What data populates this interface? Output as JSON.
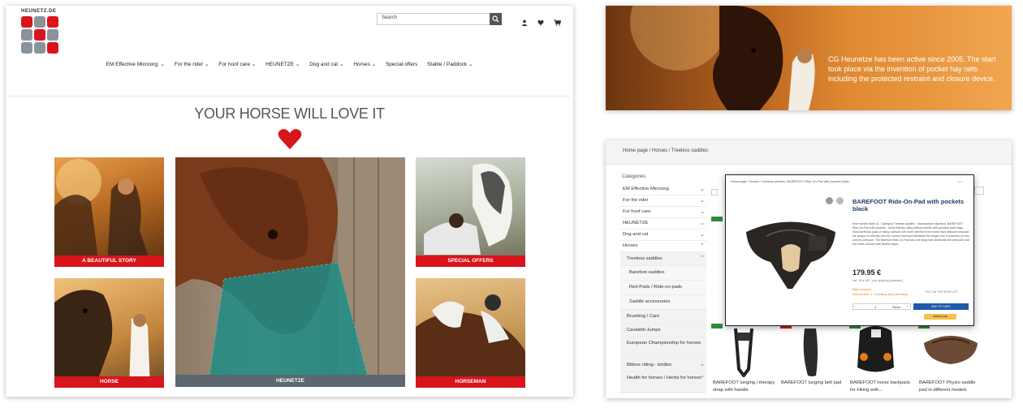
{
  "brand": {
    "logo_text": "HEUNETZ.DE"
  },
  "header": {
    "search_placeholder": "Search"
  },
  "nav": {
    "items": [
      "EM Effective Microorg. ⌄",
      "For the rider ⌄",
      "For hoof care ⌄",
      "HEUNETZE ⌄",
      "Dog and cat ⌄",
      "Horses ⌄",
      "Special offers",
      "Stable / Paddock ⌄"
    ]
  },
  "home": {
    "headline": "YOUR HORSE WILL LOVE IT",
    "tiles": [
      "A BEAUTIFUL STORY",
      "HEUNETZE",
      "SPECIAL OFFERS",
      "HORSE",
      "HORSEMAN"
    ]
  },
  "banner": {
    "text": "CG Heunetze has been active since 2005. The start took place via the invention of pocket hay nets including the protected restraint and closure device."
  },
  "shop": {
    "breadcrumb": "Home page  /  Horses  /  Treeless saddles",
    "categories_title": "Categories",
    "categories": [
      {
        "label": "EM Effective Microorg.",
        "chev": "⌄",
        "level": 0
      },
      {
        "label": "For the rider",
        "chev": "⌄",
        "level": 0
      },
      {
        "label": "For hoof care",
        "chev": "⌄",
        "level": 0
      },
      {
        "label": "HEUNETZE",
        "chev": "⌄",
        "level": 0
      },
      {
        "label": "Dog and cat",
        "chev": "⌄",
        "level": 0
      },
      {
        "label": "Horses",
        "chev": "⌃",
        "level": 0
      },
      {
        "label": "Treeless saddles",
        "chev": "⌃",
        "level": 1
      },
      {
        "label": "Barefoot saddles",
        "chev": "",
        "level": 2
      },
      {
        "label": "Reit-Pads / Ride-on-pads",
        "chev": "",
        "level": 2
      },
      {
        "label": "Saddle accessories",
        "chev": "",
        "level": 2
      },
      {
        "label": "Brushing / Care",
        "chev": "",
        "level": 1
      },
      {
        "label": "Cavaletti-Jumps",
        "chev": "",
        "level": 1
      },
      {
        "label": "European Championship for horses",
        "chev": "",
        "level": 1,
        "tall": true
      },
      {
        "label": "Bitless riding - bridles",
        "chev": "⌄",
        "level": 1
      },
      {
        "label": "Health for horses / Herbs for horses",
        "chev": "⌄",
        "level": 1,
        "tall": true
      }
    ],
    "products": [
      "BAREFOOT lunging / therapy strap with handle",
      "BAREFOOT lunging belt pad",
      "BAREFOOT horse backpack for hiking with...",
      "BAREFOOT Physio saddle pad in different models"
    ],
    "modal": {
      "breadcrumb": "Home page  /  Horses  /  Treeless saddles  /  BAREFOOT Ride-On-Pad with pockets black",
      "title": "BAREFOOT Ride-On-Pad with pockets black",
      "info": "Item number BaH-01 · Category Treeless saddles · Manufacturer Barefoot. BAREFOOT Ride-On-Pad with pockets - horse friendly riding without saddle with practical pack bags. Most bareback pads or riding cushions are more harmful to the horse than pleasant because the straps run directly over the horse's back and distribute the weight over a minimum of very uneven pressure. The Barefoot Ride-On-Pad has a tie strap that distributes the pressure over the entire cushion with flexible stays.",
      "price": "179.95 €",
      "vat": "incl. 19% VAT , plus shipping (standard)",
      "stock": "Right inventory",
      "delivery": "Delivery time: 3 - 5 working days (Germany)",
      "compare": "PUT ON THE WISH LIST",
      "qty": "1",
      "unit": "Piece",
      "cart": "ADD TO CART",
      "amazon": "amazon pay"
    }
  },
  "colors": {
    "brand_red": "#d8141d",
    "label_gray": "#5c6770"
  }
}
